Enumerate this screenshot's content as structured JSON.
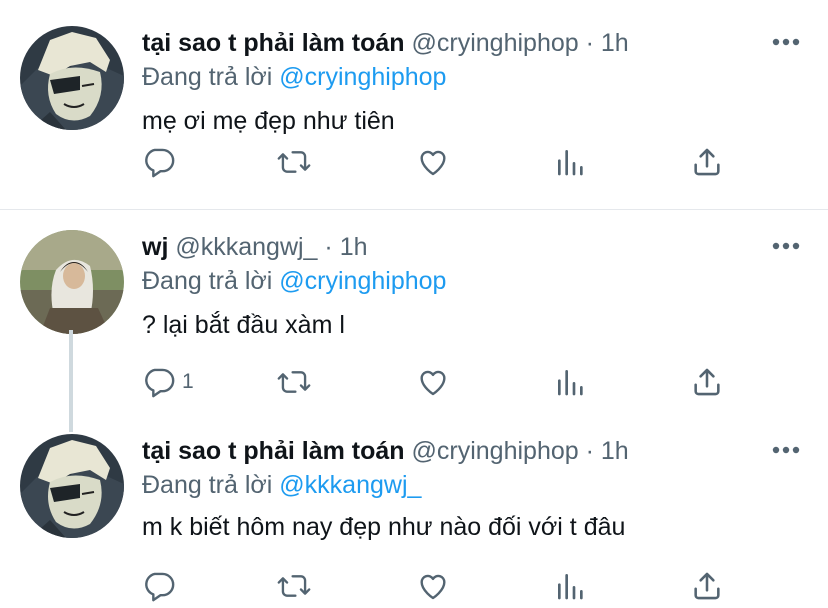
{
  "tweets": [
    {
      "display_name": "tại sao t phải làm toán",
      "handle": "@cryinghiphop",
      "separator": "·",
      "time": "1h",
      "replying_prefix": "Đang trả lời",
      "replying_to": "@cryinghiphop",
      "text": "mẹ ơi mẹ đẹp như tiên",
      "reply_count": "",
      "avatar_icon": "anime-character-avatar"
    },
    {
      "display_name": "wj",
      "handle": "@kkkangwj_",
      "separator": "·",
      "time": "1h",
      "replying_prefix": "Đang trả lời",
      "replying_to": "@cryinghiphop",
      "text": "? lại bắt đầu xàm l",
      "reply_count": "1",
      "avatar_icon": "person-photo-avatar"
    },
    {
      "display_name": "tại sao t phải làm toán",
      "handle": "@cryinghiphop",
      "separator": "·",
      "time": "1h",
      "replying_prefix": "Đang trả lời",
      "replying_to": "@kkkangwj_",
      "text": "m k biết hôm nay đẹp như nào đối với t đâu",
      "reply_count": "",
      "avatar_icon": "anime-character-avatar"
    }
  ],
  "action_icons": [
    "reply-icon",
    "retweet-icon",
    "like-icon",
    "analytics-icon",
    "share-icon"
  ],
  "colors": {
    "text_primary": "#0f1419",
    "text_secondary": "#536471",
    "link": "#1d9bf0",
    "divider": "#e5e8ec",
    "thread_line": "#cfd9de"
  }
}
